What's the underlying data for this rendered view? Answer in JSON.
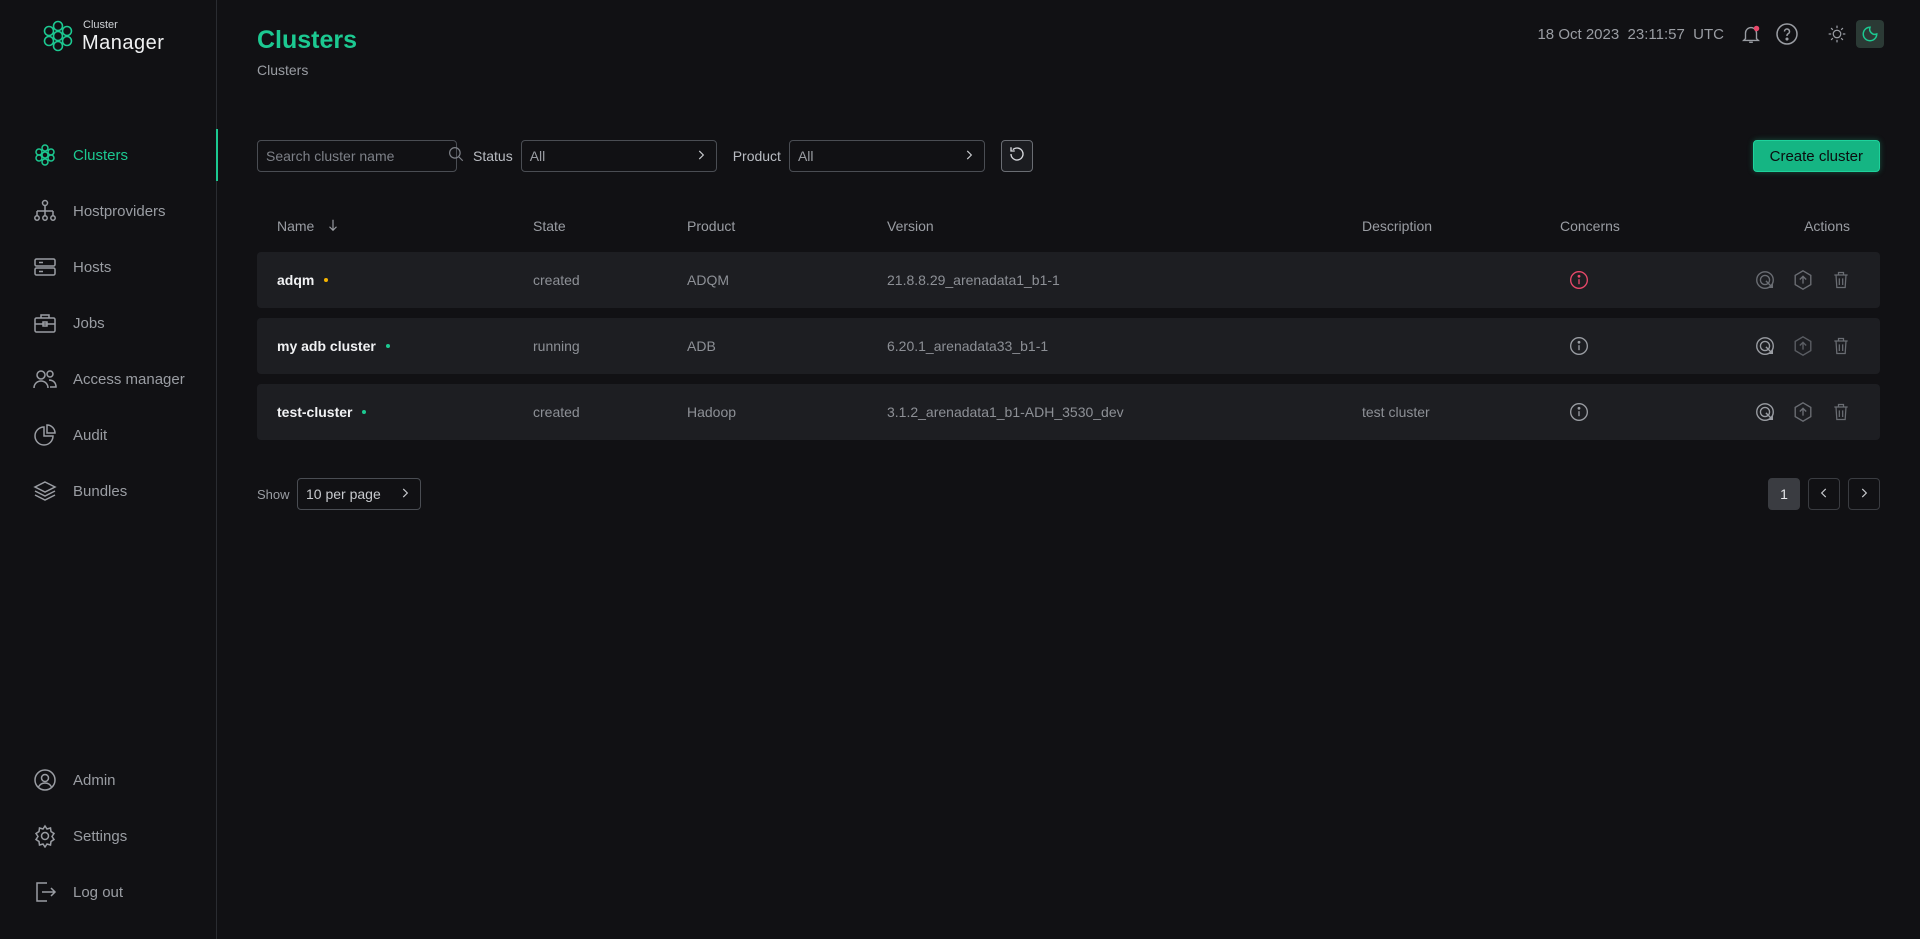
{
  "logo": {
    "small": "Cluster",
    "big": "Manager"
  },
  "sidebar": {
    "items": [
      {
        "label": "Clusters",
        "icon": "clusters-icon",
        "active": true
      },
      {
        "label": "Hostproviders",
        "icon": "hostproviders-icon"
      },
      {
        "label": "Hosts",
        "icon": "hosts-icon"
      },
      {
        "label": "Jobs",
        "icon": "jobs-icon"
      },
      {
        "label": "Access manager",
        "icon": "access-manager-icon"
      },
      {
        "label": "Audit",
        "icon": "audit-icon"
      },
      {
        "label": "Bundles",
        "icon": "bundles-icon"
      }
    ],
    "bottom": [
      {
        "label": "Admin",
        "icon": "admin-icon"
      },
      {
        "label": "Settings",
        "icon": "gear-icon"
      },
      {
        "label": "Log out",
        "icon": "logout-icon"
      }
    ]
  },
  "header": {
    "title": "Clusters",
    "breadcrumb": "Clusters",
    "date": "18 Oct 2023",
    "time": "23:11:57",
    "timezone": "UTC"
  },
  "toolbar": {
    "search_placeholder": "Search cluster name",
    "status_label": "Status",
    "status_value": "All",
    "product_label": "Product",
    "product_value": "All",
    "create_label": "Create cluster"
  },
  "table": {
    "headers": {
      "name": "Name",
      "state": "State",
      "product": "Product",
      "version": "Version",
      "description": "Description",
      "concerns": "Concerns",
      "actions": "Actions"
    },
    "rows": [
      {
        "name": "adqm",
        "status_color": "#f5b300",
        "state": "created",
        "product": "ADQM",
        "version": "21.8.8.29_arenadata1_b1-1",
        "description": "",
        "concern_color": "#e8486a"
      },
      {
        "name": "my adb cluster",
        "status_color": "#1cc991",
        "state": "running",
        "product": "ADB",
        "version": "6.20.1_arenadata33_b1-1",
        "description": "",
        "concern_color": "#9a9da3"
      },
      {
        "name": "test-cluster",
        "status_color": "#1cc991",
        "state": "created",
        "product": "Hadoop",
        "version": "3.1.2_arenadata1_b1-ADH_3530_dev",
        "description": "test cluster",
        "concern_color": "#9a9da3"
      }
    ]
  },
  "pagination": {
    "show_label": "Show",
    "per_page": "10 per page",
    "current_page": "1"
  },
  "colors": {
    "accent": "#1cc991",
    "background": "#111114",
    "row": "#1d1e22"
  }
}
